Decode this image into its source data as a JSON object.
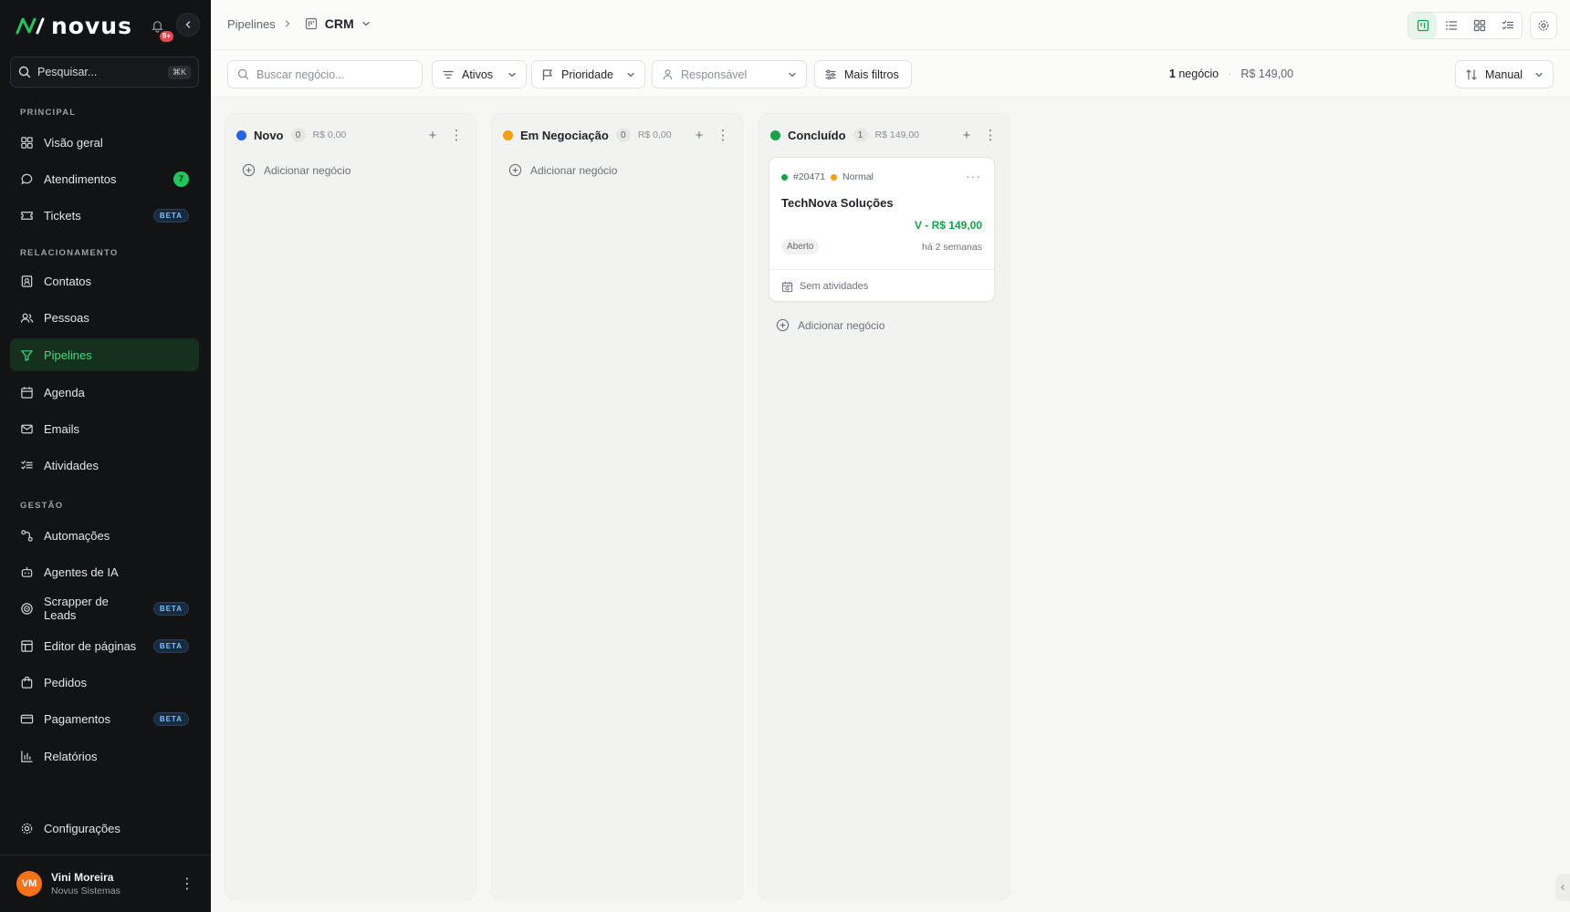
{
  "brand": {
    "name": "novus",
    "notification_badge": "9+"
  },
  "sidebar": {
    "search_placeholder": "Pesquisar...",
    "search_shortcut": "⌘K",
    "sections": {
      "principal": "PRINCIPAL",
      "relacionamento": "RELACIONAMENTO",
      "gestao": "GESTÃO"
    },
    "items": {
      "visao_geral": "Visão geral",
      "atendimentos": "Atendimentos",
      "atendimentos_count": "7",
      "tickets": "Tickets",
      "contatos": "Contatos",
      "pessoas": "Pessoas",
      "pipelines": "Pipelines",
      "agenda": "Agenda",
      "emails": "Emails",
      "atividades": "Atividades",
      "automacoes": "Automações",
      "agentes": "Agentes de IA",
      "scrapper": "Scrapper de Leads",
      "editor": "Editor de páginas",
      "pedidos": "Pedidos",
      "pagamentos": "Pagamentos",
      "relatorios": "Relatórios",
      "configuracoes": "Configurações"
    },
    "beta_label": "BETA",
    "active_item": "pipelines",
    "user": {
      "initials": "VM",
      "name": "Vini Moreira",
      "org": "Novus Sistemas"
    }
  },
  "header": {
    "breadcrumb_parent": "Pipelines",
    "breadcrumb_current": "CRM",
    "active_view": "kanban"
  },
  "filters": {
    "search_placeholder": "Buscar negócio...",
    "status": "Ativos",
    "priority": "Prioridade",
    "owner_placeholder": "Responsável",
    "more": "Mais filtros",
    "summary_count": "1",
    "summary_count_label": "negócio",
    "summary_total": "R$ 149,00",
    "sort": "Manual"
  },
  "board": {
    "add_deal_label": "Adicionar negócio",
    "columns": [
      {
        "name": "Novo",
        "count": "0",
        "value": "R$ 0,00",
        "color": "#2563eb"
      },
      {
        "name": "Em Negociação",
        "count": "0",
        "value": "R$ 0,00",
        "color": "#f59e0b"
      },
      {
        "name": "Concluído",
        "count": "1",
        "value": "R$ 149,00",
        "color": "#16a34a"
      }
    ],
    "card": {
      "id": "#20471",
      "priority": "Normal",
      "title": "TechNova Soluções",
      "value": "V - R$ 149,00",
      "status": "Aberto",
      "time": "há 2 semanas",
      "activities": "Sem atividades"
    }
  },
  "colors": {
    "accent": "#22c55e",
    "sidebar_bg": "#111315",
    "card_value": "#16a34a"
  }
}
